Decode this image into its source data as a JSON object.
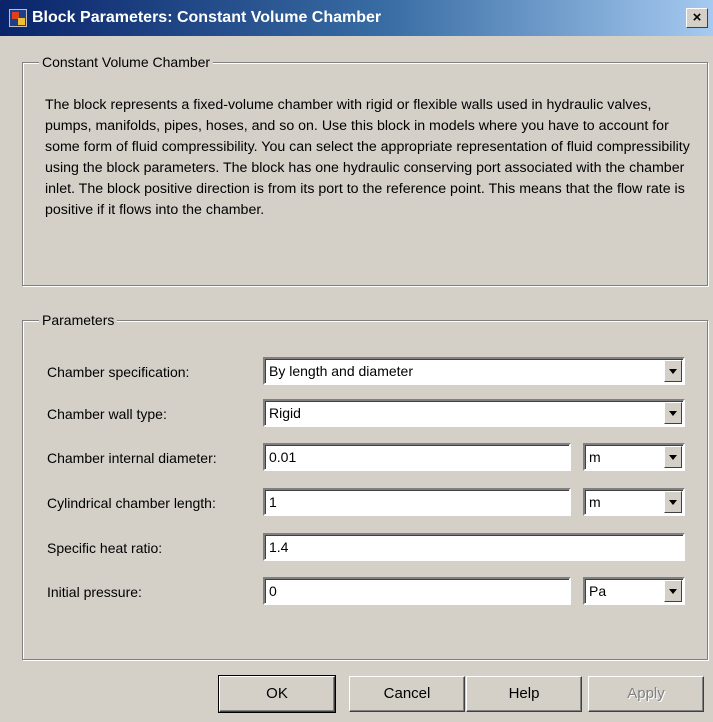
{
  "window": {
    "title": "Block Parameters: Constant Volume Chamber",
    "close_glyph": "×"
  },
  "description": {
    "group_label": "Constant Volume Chamber",
    "text": "The block represents a fixed-volume chamber with rigid or flexible walls used in hydraulic valves, pumps, manifolds, pipes, hoses, and so on. Use this block in models where you have to account for some form of fluid compressibility. You can select the appropriate representation of fluid compressibility using the block parameters. The block has one hydraulic conserving port associated with the chamber inlet. The block positive direction is from its port to the reference point. This means that the flow rate is positive if it flows into the chamber."
  },
  "parameters": {
    "group_label": "Parameters",
    "chamber_specification": {
      "label": "Chamber specification:",
      "value": "By length and diameter"
    },
    "chamber_wall_type": {
      "label": "Chamber wall type:",
      "value": "Rigid"
    },
    "chamber_internal_diameter": {
      "label": "Chamber internal diameter:",
      "value": "0.01",
      "unit": "m"
    },
    "cylindrical_chamber_length": {
      "label": "Cylindrical chamber length:",
      "value": "1",
      "unit": "m"
    },
    "specific_heat_ratio": {
      "label": "Specific heat ratio:",
      "value": "1.4"
    },
    "initial_pressure": {
      "label": "Initial pressure:",
      "value": "0",
      "unit": "Pa"
    }
  },
  "buttons": {
    "ok": "OK",
    "cancel": "Cancel",
    "help": "Help",
    "apply": "Apply"
  }
}
